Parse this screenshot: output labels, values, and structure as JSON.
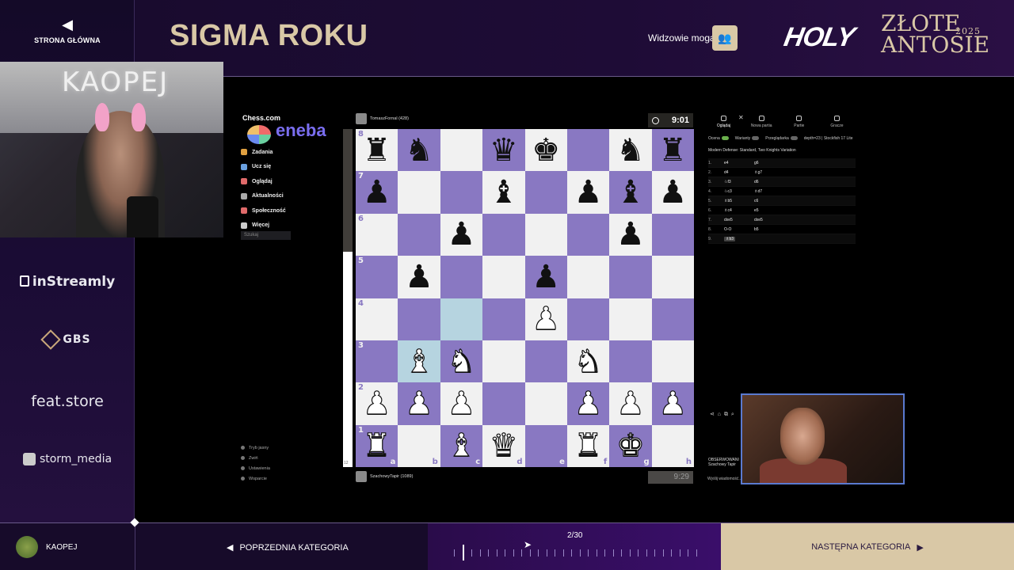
{
  "header": {
    "home_label": "STRONA GŁÓWNA",
    "title": "SIGMA ROKU",
    "viewers_label": "Widzowie mogą",
    "logo_holy": "HOLY",
    "logo_zlote": "ZŁOTE",
    "logo_antosie": "ANTOSIE",
    "logo_year": "2025"
  },
  "sponsors": [
    "inStreamly",
    "GBS",
    "feat.store",
    "storm_media"
  ],
  "webcam": {
    "neon_text": "KAOPEJ"
  },
  "chesscom": {
    "brand": "Chess.com",
    "ad": "eneba",
    "nav": [
      {
        "label": "Zadania",
        "color": "#e0a040"
      },
      {
        "label": "Ucz się",
        "color": "#6aa0e0"
      },
      {
        "label": "Oglądaj",
        "color": "#e06a6a"
      },
      {
        "label": "Aktualności",
        "color": "#aaaaaa"
      },
      {
        "label": "Społeczność",
        "color": "#e06a6a"
      },
      {
        "label": "Więcej",
        "color": "#cccccc"
      }
    ],
    "search_placeholder": "Szukaj",
    "bottom_links": [
      "Tryb jasny",
      "Zwiń",
      "Ustawienia",
      "Wsparcie"
    ]
  },
  "game": {
    "top_player": "TomaszFornal (428)",
    "bottom_player": "SzachowyTapir (1089)",
    "top_clock": "9:01",
    "bottom_clock": "9:29",
    "eval_bottom": "12",
    "board": [
      [
        "r",
        "n",
        "",
        "q",
        "k",
        "",
        "n",
        "r"
      ],
      [
        "p",
        "",
        "",
        "b",
        "",
        "p",
        "b",
        "p"
      ],
      [
        "",
        "",
        "p",
        "",
        "",
        "",
        "p",
        ""
      ],
      [
        "",
        "p",
        "",
        "",
        "p",
        "",
        "",
        ""
      ],
      [
        "",
        "",
        "",
        "",
        "P",
        "",
        "",
        ""
      ],
      [
        "",
        "B",
        "N",
        "",
        "",
        "N",
        "",
        ""
      ],
      [
        "P",
        "P",
        "P",
        "",
        "",
        "P",
        "P",
        "P"
      ],
      [
        "R",
        "",
        "B",
        "Q",
        "",
        "R",
        "K",
        ""
      ]
    ],
    "highlights": [
      "c4",
      "b3"
    ],
    "ranks": [
      "8",
      "7",
      "6",
      "5",
      "4",
      "3",
      "2",
      "1"
    ],
    "files": [
      "a",
      "b",
      "c",
      "d",
      "e",
      "f",
      "g",
      "h"
    ]
  },
  "analysis": {
    "tabs": [
      "Oglądaj",
      "Nowa partia",
      "Partie",
      "Gracze"
    ],
    "options": {
      "eval": "Ocena",
      "variants": "Warianty",
      "preview": "Przeglądarka",
      "engine": "depth=23 | Stockfish 17 Lite"
    },
    "opening": "Modern Defense: Standard, Two Knights Variation",
    "moves": [
      {
        "n": "1.",
        "w": "e4",
        "b": "g6"
      },
      {
        "n": "2.",
        "w": "d4",
        "b": "♗g7"
      },
      {
        "n": "3.",
        "w": "♘f3",
        "b": "d6"
      },
      {
        "n": "4.",
        "w": "♘c3",
        "b": "♗d7"
      },
      {
        "n": "5.",
        "w": "♗b5",
        "b": "c6"
      },
      {
        "n": "6.",
        "w": "♗c4",
        "b": "e5"
      },
      {
        "n": "7.",
        "w": "dxe5",
        "b": "dxe5"
      },
      {
        "n": "8.",
        "w": "O-O",
        "b": "b5"
      },
      {
        "n": "9.",
        "w": "♗b3",
        "b": ""
      }
    ],
    "observe_title": "OBSERWOWANI",
    "observe_user": "Szachowy Tapir",
    "message_placeholder": "Wyślij wiadomość..."
  },
  "bottom": {
    "username": "KAOPEJ",
    "prev_label": "POPRZEDNIA KATEGORIA",
    "counter": "2/30",
    "next_label": "NASTĘPNA KATEGORIA",
    "current": 2,
    "total": 30
  }
}
